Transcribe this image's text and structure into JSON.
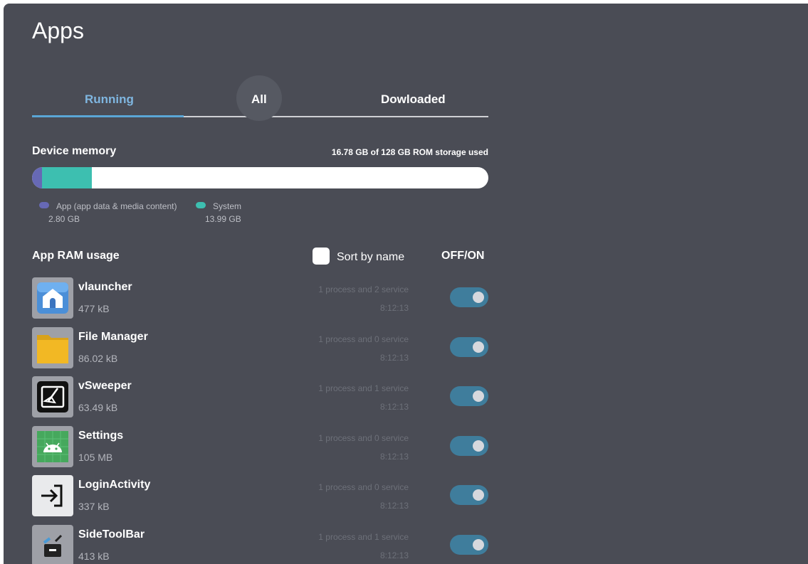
{
  "page": {
    "title": "Apps"
  },
  "tabs": [
    {
      "label": "Running"
    },
    {
      "label": "All"
    },
    {
      "label": "Dowloaded"
    }
  ],
  "memory": {
    "label": "Device memory",
    "used_text": "16.78 GB of 128 GB ROM storage used",
    "legend": [
      {
        "name": "App (app data & media content)",
        "size": "2.80 GB",
        "color": "#6769b5"
      },
      {
        "name": "System",
        "size": "13.99 GB",
        "color": "#3dbfb0"
      }
    ],
    "total_gb": 128,
    "app_gb": 2.8,
    "system_gb": 13.99
  },
  "ram": {
    "label": "App RAM usage",
    "sort_label": "Sort by name",
    "toggle_header": "OFF/ON",
    "apps": [
      {
        "name": "vlauncher",
        "size": "477 kB",
        "processes": "1 process and 2 service",
        "time": "8:12:13",
        "icon": "home-icon",
        "on": true
      },
      {
        "name": "File Manager",
        "size": "86.02 kB",
        "processes": "1 process and 0 service",
        "time": "8:12:13",
        "icon": "folder-icon",
        "on": true
      },
      {
        "name": "vSweeper",
        "size": "63.49 kB",
        "processes": "1 process and 1 service",
        "time": "8:12:13",
        "icon": "broom-icon",
        "on": true
      },
      {
        "name": "Settings",
        "size": "105 MB",
        "processes": "1 process and 0 service",
        "time": "8:12:13",
        "icon": "android-icon",
        "on": true
      },
      {
        "name": "LoginActivity",
        "size": "337 kB",
        "processes": "1 process and 0 service",
        "time": "8:12:13",
        "icon": "login-arrow-icon",
        "on": true
      },
      {
        "name": "SideToolBar",
        "size": "413 kB",
        "processes": "1 process and 1 service",
        "time": "8:12:13",
        "icon": "toolbox-icon",
        "on": true
      }
    ]
  },
  "colors": {
    "background": "#4a4c55",
    "accent": "#5aa6d6",
    "toggle_on": "#3f7d9c"
  }
}
